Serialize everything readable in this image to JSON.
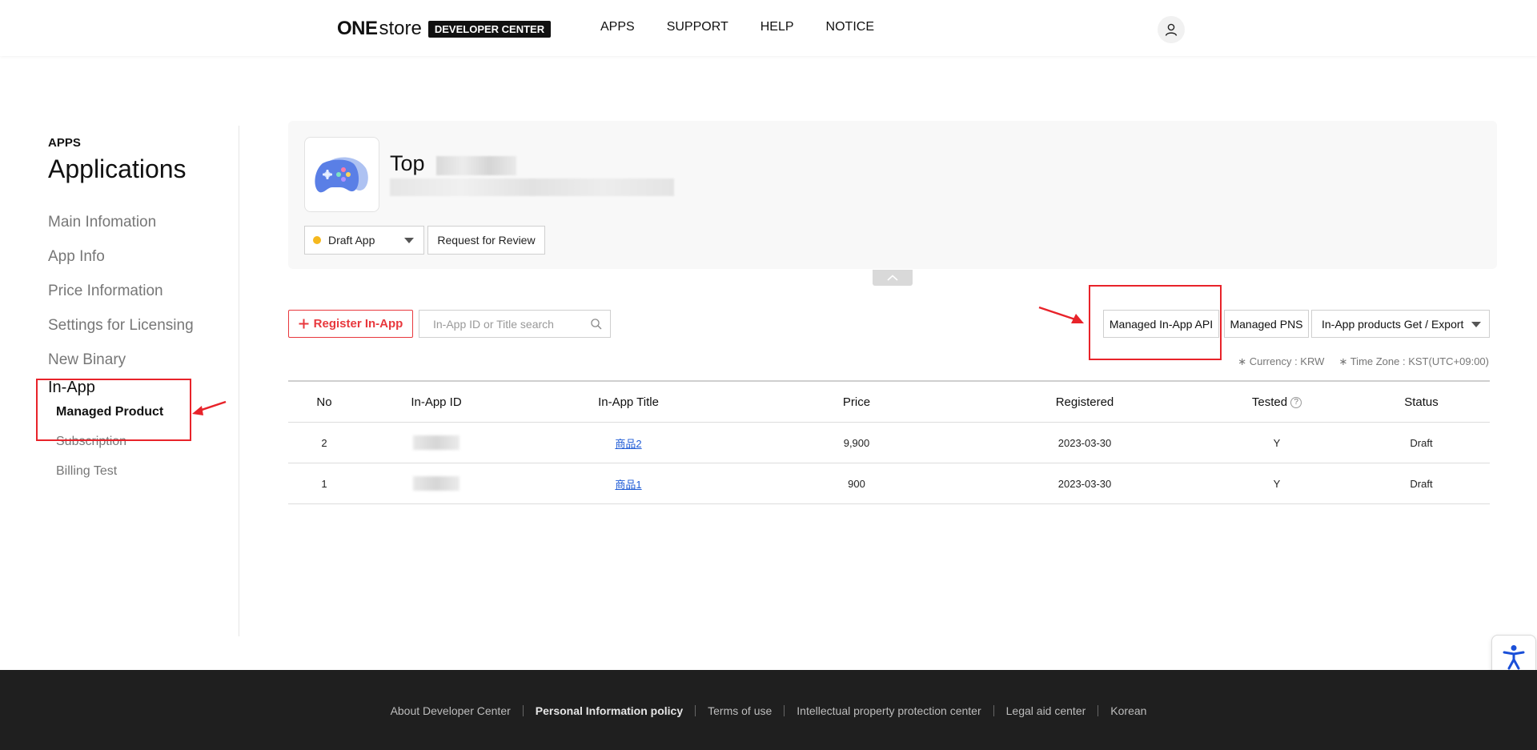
{
  "header": {
    "logo_one": "ONE",
    "logo_store": "store",
    "logo_dev": "DEVELOPER CENTER",
    "nav": [
      "APPS",
      "SUPPORT",
      "HELP",
      "NOTICE"
    ],
    "user_icon": "user-icon"
  },
  "sidebar": {
    "section": "APPS",
    "title": "Applications",
    "items": [
      "Main Infomation",
      "App Info",
      "Price Information",
      "Settings for Licensing",
      "New Binary"
    ],
    "inapp": {
      "label": "In-App",
      "subitems": [
        "Managed Product",
        "Subscription",
        "Billing Test"
      ],
      "active": "Managed Product"
    }
  },
  "app": {
    "name": "Top",
    "status_select": "Draft App",
    "status_color": "#f5b81e",
    "review_button": "Request for Review"
  },
  "toolbar": {
    "register_label": "Register In-App",
    "search_placeholder": "In-App ID or Title search",
    "api_button": "Managed In-App API",
    "pns_button": "Managed PNS",
    "export_select": "In-App products Get / Export",
    "currency": "∗ Currency : KRW",
    "timezone": "∗ Time Zone : KST(UTC+09:00)"
  },
  "table": {
    "headers": {
      "no": "No",
      "id": "In-App ID",
      "title": "In-App Title",
      "price": "Price",
      "registered": "Registered",
      "tested": "Tested",
      "status": "Status"
    },
    "rows": [
      {
        "no": "2",
        "title": "商品2",
        "price": "9,900",
        "registered": "2023-03-30",
        "tested": "Y",
        "status": "Draft"
      },
      {
        "no": "1",
        "title": "商品1",
        "price": "900",
        "registered": "2023-03-30",
        "tested": "Y",
        "status": "Draft"
      }
    ]
  },
  "footer": {
    "links": [
      "About Developer Center",
      "Personal Information policy",
      "Terms of use",
      "Intellectual property protection center",
      "Legal aid center",
      "Korean"
    ]
  },
  "colors": {
    "accent": "#e8383d",
    "annotation": "#e8232a",
    "link": "#1e5bd6",
    "footer_bg": "#1f1f1f"
  }
}
